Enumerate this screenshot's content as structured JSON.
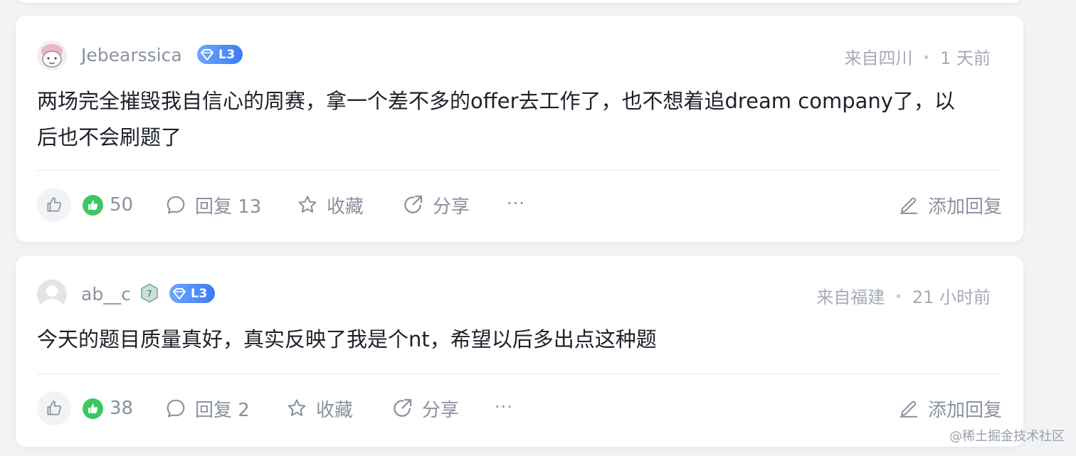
{
  "comments": [
    {
      "username": "Jebearssica",
      "level": "L3",
      "location": "来自四川",
      "time": "1 天前",
      "content_line1": "两场完全摧毁我自信心的周赛，拿一个差不多的offer去工作了，也不想着追dream company了，以",
      "content_line2": "后也不会刷题了",
      "likes": "50",
      "reply_label": "回复 13",
      "collect_label": "收藏",
      "share_label": "分享",
      "more_label": "···",
      "add_reply_label": "添加回复"
    },
    {
      "username": "ab__c",
      "badge": "7",
      "level": "L3",
      "location": "来自福建",
      "time": "21 小时前",
      "content_line1": "今天的题目质量真好，真实反映了我是个nt，希望以后多出点这种题",
      "likes": "38",
      "reply_label": "回复 2",
      "collect_label": "收藏",
      "share_label": "分享",
      "more_label": "···",
      "add_reply_label": "添加回复"
    }
  ],
  "meta_separator": "•",
  "watermark": "@稀土掘金技术社区",
  "icons": {
    "like": "thumb-up-icon",
    "reply": "comment-icon",
    "collect": "star-icon",
    "share": "share-icon",
    "edit": "pen-icon"
  },
  "colors": {
    "background": "#f2f3f5",
    "like_green": "#3cc761",
    "level_blue": "#3b7bf7",
    "muted_text": "#8a919f"
  }
}
